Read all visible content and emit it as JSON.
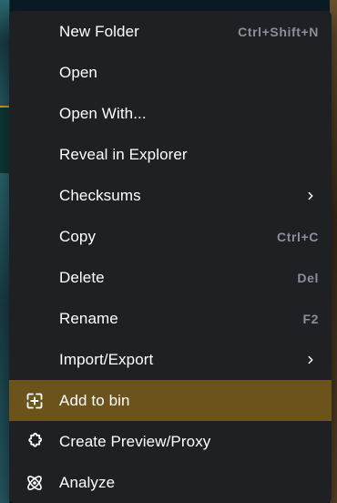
{
  "menu": {
    "items": [
      {
        "label": "New Folder",
        "shortcut": "Ctrl+Shift+N"
      },
      {
        "label": "Open"
      },
      {
        "label": "Open With..."
      },
      {
        "label": "Reveal in Explorer"
      },
      {
        "label": "Checksums",
        "submenu_icon": "chevron-right-icon"
      },
      {
        "label": "Copy",
        "shortcut": "Ctrl+C"
      },
      {
        "label": "Delete",
        "shortcut": "Del"
      },
      {
        "label": "Rename",
        "shortcut": "F2"
      },
      {
        "label": "Import/Export",
        "submenu_icon": "chevron-right-icon"
      },
      {
        "label": "Add to bin",
        "icon": "add-to-bin-icon",
        "state": "highlighted"
      },
      {
        "label": "Create Preview/Proxy",
        "icon": "puzzle-icon"
      },
      {
        "label": "Analyze",
        "icon": "atom-icon"
      }
    ],
    "colors": {
      "menu_bg": "#1f2024",
      "highlight_bg": "#6b531b",
      "text": "#ffffff",
      "shortcut_text": "#8a8f98",
      "accent_orange": "#e3a11a"
    }
  }
}
